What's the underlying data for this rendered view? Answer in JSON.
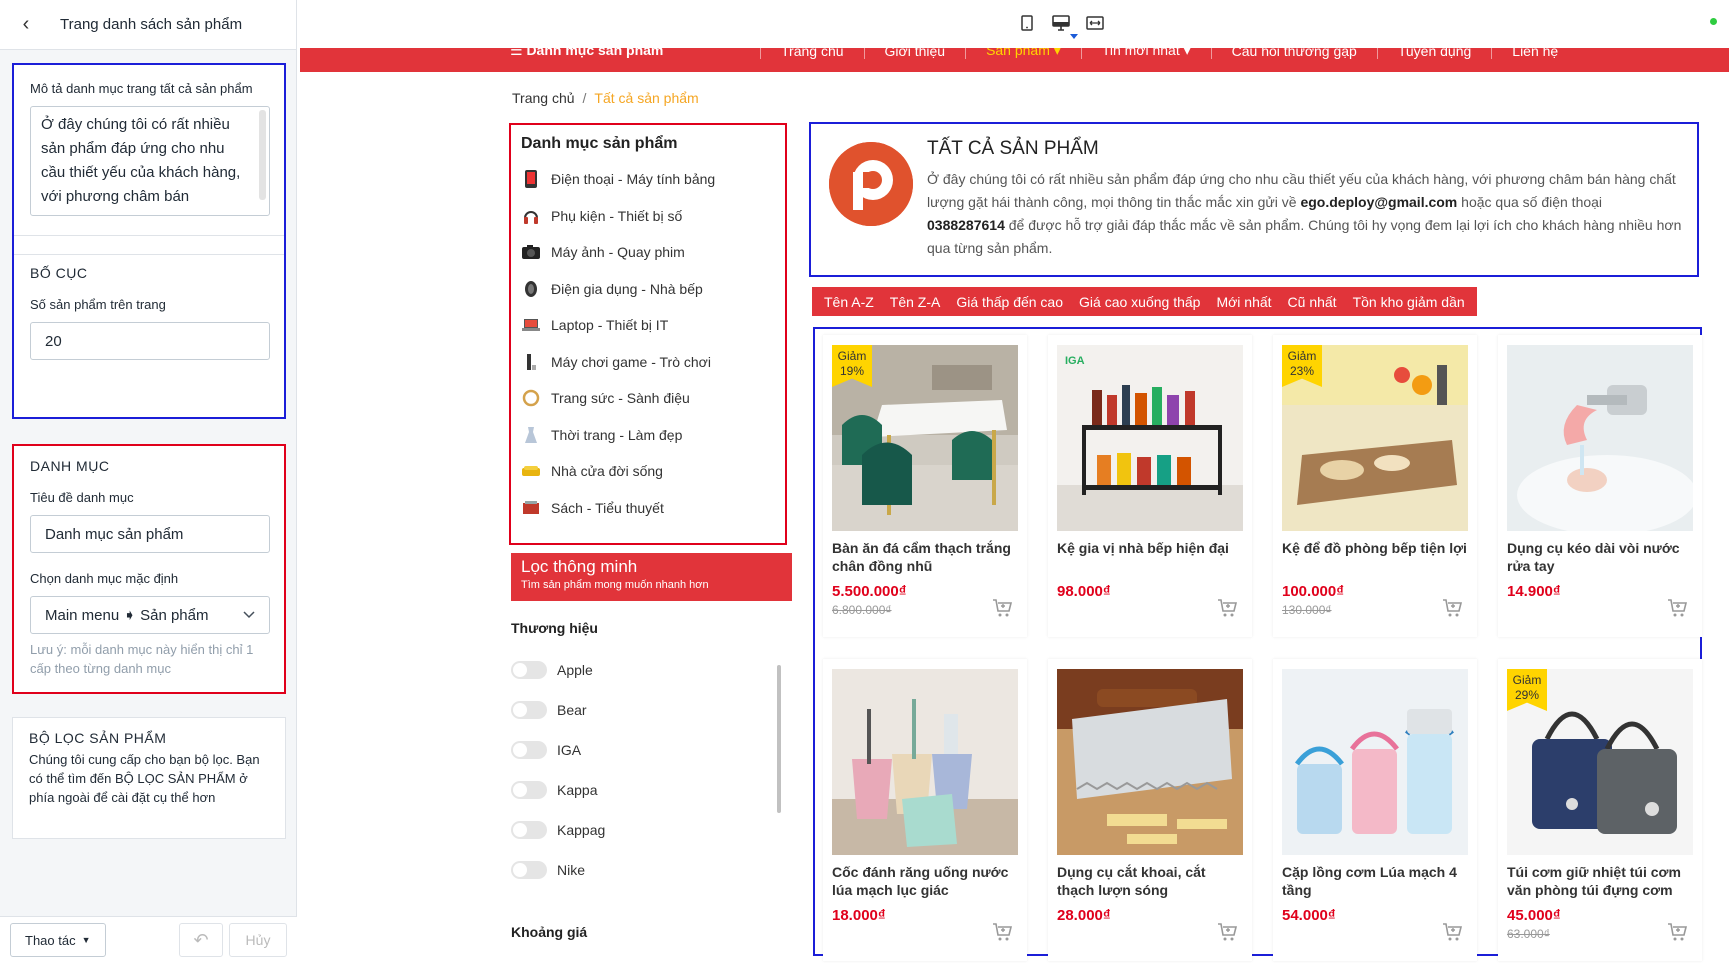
{
  "editor": {
    "title": "Trang danh sách sản phẩm",
    "description": {
      "label": "Mô tả danh mục trang tất cả sản phẩm",
      "value": "Ở đây chúng tôi có rất nhiều sản phẩm đáp ứng cho nhu cầu thiết yếu của khách hàng, với phương châm bán"
    },
    "layout": {
      "heading": "BỐ CỤC",
      "per_page_label": "Số sản phẩm trên trang",
      "per_page_value": "20"
    },
    "category": {
      "heading": "DANH MỤC",
      "title_label": "Tiêu đề danh mục",
      "title_value": "Danh mục sản phẩm",
      "default_label": "Chọn danh mục mặc định",
      "default_value": "Main menu ➧ Sản phẩm",
      "note": "Lưu ý: mỗi danh mục này hiển thị chỉ 1 cấp theo từng danh mục"
    },
    "filter": {
      "heading": "BỘ LỌC SẢN PHẨM",
      "desc": "Chúng tôi cung cấp cho bạn bộ lọc. Bạn có thể tìm đến BỘ LỌC SẢN PHẨM ở phía ngoài để cài đặt cụ thể hơn"
    },
    "footer": {
      "actions": "Thao tác",
      "cancel": "Hủy"
    }
  },
  "site": {
    "nav": {
      "categories": "☰ Danh mục sản phẩm",
      "links": [
        "Trang chủ",
        "Giới thiệu",
        "Sản phẩm ▾",
        "Tin mới nhất ▾",
        "Câu hỏi thường gặp",
        "Tuyển dụng",
        "Liên hệ"
      ]
    },
    "breadcrumb": {
      "home": "Trang chủ",
      "sep": "/",
      "current": "Tất cả sản phẩm"
    },
    "sidebar": {
      "title": "Danh mục sản phẩm",
      "items": [
        "Điện thoại - Máy tính bảng",
        "Phụ kiện - Thiết bị số",
        "Máy ảnh - Quay phim",
        "Điện gia dụng - Nhà bếp",
        "Laptop - Thiết bị IT",
        "Máy chơi game - Trò chơi",
        "Trang sức - Sành điệu",
        "Thời trang - Làm đẹp",
        "Nhà cửa đời sống",
        "Sách - Tiểu thuyết"
      ],
      "smart_filter_title": "Lọc thông minh",
      "smart_filter_sub": "Tìm sản phẩm mong muốn nhanh hơn",
      "brand_heading": "Thương hiệu",
      "brands": [
        "Apple",
        "Bear",
        "IGA",
        "Kappa",
        "Kappag",
        "Nike"
      ],
      "price_heading": "Khoảng giá"
    },
    "collection": {
      "logo_letter": "P",
      "title": "TẤT CẢ SẢN PHẨM",
      "desc_1": "Ở đây chúng tôi có rất nhiều sản phẩm đáp ứng cho nhu cầu thiết yếu của khách hàng, với phương châm bán hàng chất lượng gặt hái thành công, mọi thông tin thắc mắc xin gửi về ",
      "email": "ego.deploy@gmail.com",
      "desc_2": " hoặc qua số điện thoại ",
      "phone": "0388287614",
      "desc_3": " để được hỗ trợ giải đáp thắc mắc về sản phẩm. Chúng tôi hy vọng đem lại lợi ích cho khách hàng nhiều hơn qua từng sản phẩm."
    },
    "sort": [
      "Tên A-Z",
      "Tên Z-A",
      "Giá thấp đến cao",
      "Giá cao xuống thấp",
      "Mới nhất",
      "Cũ nhất",
      "Tồn kho giảm dần"
    ],
    "products": [
      {
        "name": "Bàn ăn đá cẩm thạch trắng chân đồng nhũ",
        "price": "5.500.000₫",
        "old": "6.800.000₫",
        "badge": "Giảm 19%"
      },
      {
        "name": "Kệ gia vị nhà bếp hiện đại",
        "price": "98.000₫",
        "old": "",
        "badge": ""
      },
      {
        "name": "Kệ để đồ phòng bếp tiện lợi",
        "price": "100.000₫",
        "old": "130.000₫",
        "badge": "Giảm 23%"
      },
      {
        "name": "Dụng cụ kéo dài vòi nước rửa tay",
        "price": "14.900₫",
        "old": "",
        "badge": ""
      },
      {
        "name": "Cốc đánh răng uống nước lúa mạch lục giác",
        "price": "18.000₫",
        "old": "",
        "badge": ""
      },
      {
        "name": "Dụng cụ cắt khoai, cắt thạch lượn sóng",
        "price": "28.000₫",
        "old": "",
        "badge": ""
      },
      {
        "name": "Cặp lồng cơm Lúa mạch 4 tầng",
        "price": "54.000₫",
        "old": "",
        "badge": ""
      },
      {
        "name": "Túi cơm giữ nhiệt túi cơm văn phòng túi đựng cơm",
        "price": "45.000₫",
        "old": "63.000₫",
        "badge": "Giảm 29%"
      }
    ],
    "iga_logo": "IGA"
  }
}
